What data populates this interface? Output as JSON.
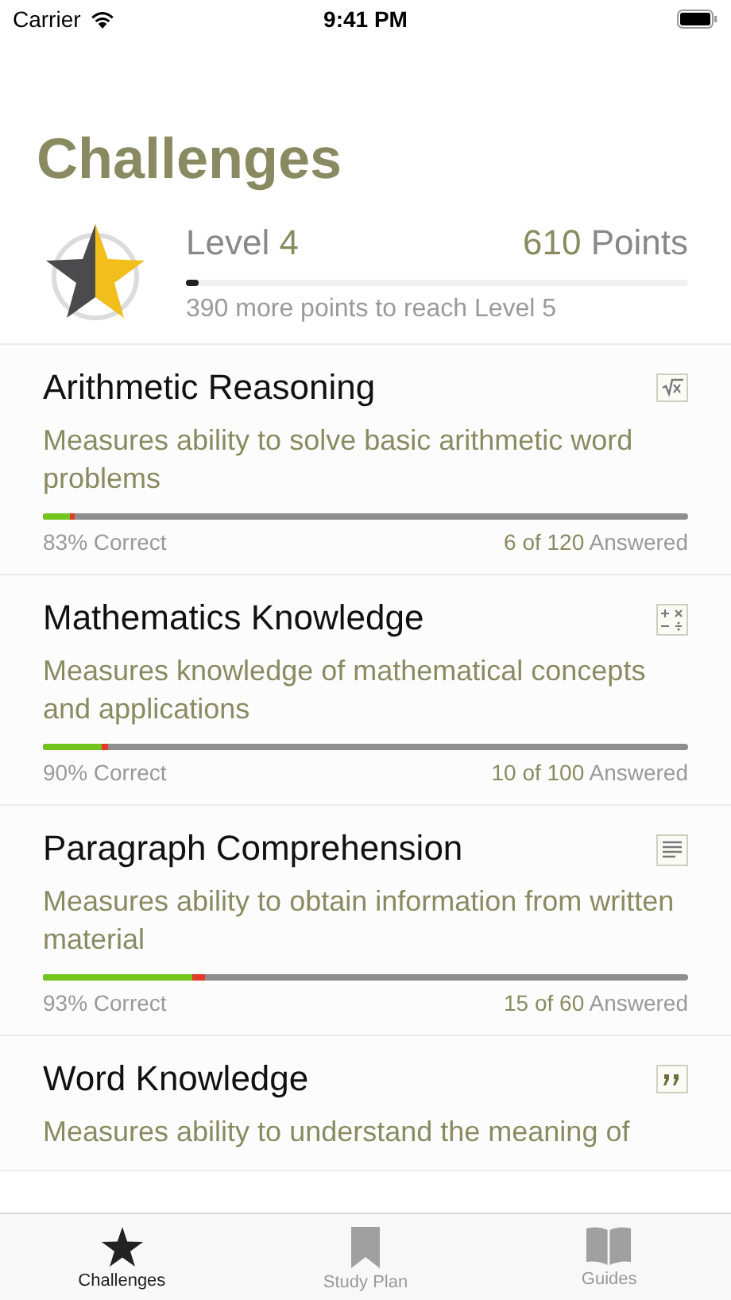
{
  "status_bar": {
    "carrier": "Carrier",
    "time": "9:41 PM"
  },
  "title": "Challenges",
  "level_summary": {
    "level_label": "Level",
    "level_value": "4",
    "points_value": "610",
    "points_label": "Points",
    "progress": {
      "level": 0.02
    },
    "caption": "390 more points to reach Level 5"
  },
  "challenges": [
    {
      "title": "Arithmetic Reasoning",
      "description": "Measures ability to solve basic arithmetic word problems",
      "answered": {
        "level": 0.05
      },
      "correct": {
        "level": 0.83
      },
      "correct_text": "83% Correct",
      "answered_count": "6 of 120",
      "answered_label": "Answered"
    },
    {
      "title": "Mathematics Knowledge",
      "description": "Measures knowledge of mathematical concepts and applications",
      "answered": {
        "level": 0.1
      },
      "correct": {
        "level": 0.9
      },
      "correct_text": "90% Correct",
      "answered_count": "10 of 100",
      "answered_label": "Answered"
    },
    {
      "title": "Paragraph Comprehension",
      "description": "Measures ability to obtain information from written material",
      "answered": {
        "level": 0.25
      },
      "correct": {
        "level": 0.93
      },
      "correct_text": "93% Correct",
      "answered_count": "15 of 60",
      "answered_label": "Answered"
    },
    {
      "title": "Word Knowledge",
      "description": "Measures ability to understand the meaning of"
    }
  ],
  "tabs": [
    {
      "label": "Challenges",
      "selected": true
    },
    {
      "label": "Study Plan",
      "selected": false
    },
    {
      "label": "Guides",
      "selected": false
    }
  ]
}
